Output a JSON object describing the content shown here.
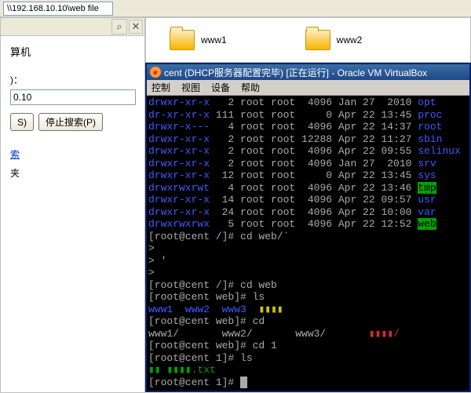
{
  "addressbar": {
    "path": "\\\\192.168.10.10\\web file"
  },
  "left_panel": {
    "title": "算机",
    "label": ")：",
    "input": "0.10",
    "search_btn": "S)",
    "stop_btn": "停止搜索(P)",
    "link_search_others": "索",
    "link_folders": "夹"
  },
  "folders": [
    {
      "name": "www1"
    },
    {
      "name": "www2"
    }
  ],
  "vb": {
    "title": "cent (DHCP服务器配置完毕) [正在运行] - Oracle VM VirtualBox",
    "menu": [
      "控制",
      "视图",
      "设备",
      "帮助"
    ],
    "lines": [
      {
        "perm": "drwxr-xr-x",
        "n": "2",
        "u": "root",
        "g": "root",
        "sz": "4096",
        "date": "Jan 27  2010",
        "name": "opt",
        "cls": "blue"
      },
      {
        "perm": "dr-xr-xr-x",
        "n": "111",
        "u": "root",
        "g": "root",
        "sz": "0",
        "date": "Apr 22 13:45",
        "name": "proc",
        "cls": "blue"
      },
      {
        "perm": "drwxr-x---",
        "n": "4",
        "u": "root",
        "g": "root",
        "sz": "4096",
        "date": "Apr 22 14:37",
        "name": "root",
        "cls": "blue"
      },
      {
        "perm": "drwxr-xr-x",
        "n": "2",
        "u": "root",
        "g": "root",
        "sz": "12288",
        "date": "Apr 22 11:27",
        "name": "sbin",
        "cls": "blue"
      },
      {
        "perm": "drwxr-xr-x",
        "n": "2",
        "u": "root",
        "g": "root",
        "sz": "4096",
        "date": "Apr 22 09:55",
        "name": "selinux",
        "cls": "blue"
      },
      {
        "perm": "drwxr-xr-x",
        "n": "2",
        "u": "root",
        "g": "root",
        "sz": "4096",
        "date": "Jan 27  2010",
        "name": "srv",
        "cls": "blue"
      },
      {
        "perm": "drwxr-xr-x",
        "n": "12",
        "u": "root",
        "g": "root",
        "sz": "0",
        "date": "Apr 22 13:45",
        "name": "sys",
        "cls": "blue"
      },
      {
        "perm": "drwxrwxrwt",
        "n": "4",
        "u": "root",
        "g": "root",
        "sz": "4096",
        "date": "Apr 22 13:46",
        "name": "tmp",
        "cls": "green-hl"
      },
      {
        "perm": "drwxr-xr-x",
        "n": "14",
        "u": "root",
        "g": "root",
        "sz": "4096",
        "date": "Apr 22 09:57",
        "name": "usr",
        "cls": "blue"
      },
      {
        "perm": "drwxr-xr-x",
        "n": "24",
        "u": "root",
        "g": "root",
        "sz": "4096",
        "date": "Apr 22 10:00",
        "name": "var",
        "cls": "blue"
      },
      {
        "perm": "drwxrwxrwx",
        "n": "5",
        "u": "root",
        "g": "root",
        "sz": "4096",
        "date": "Apr 22 12:52",
        "name": "web",
        "cls": "green-hl"
      }
    ],
    "cmd1": "[root@cent /]# cd web/`",
    "cont1": ">",
    "cont2": "> '",
    "cont3": ">",
    "cmd2": "[root@cent /]# cd web",
    "cmd3": "[root@cent web]# ls",
    "ls1": "www1  www2  www3  ",
    "ls1_yellow": "▮▮▮▮",
    "cmd4": "[root@cent web]# cd",
    "ls2": "www1/       www2/       www3/       ",
    "ls2_red": "▮▮▮▮/",
    "cmd5": "[root@cent web]# cd 1",
    "cmd6": "[root@cent 1]# ls",
    "ls3_txt": "▮▮ ▮▮▮▮.txt",
    "prompt_final": "[root@cent 1]# "
  }
}
